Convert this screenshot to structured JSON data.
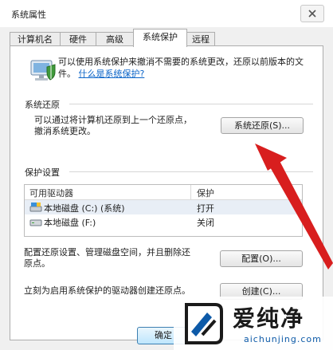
{
  "window": {
    "title": "系统属性"
  },
  "tabs": [
    {
      "label": "计算机名",
      "active": false
    },
    {
      "label": "硬件",
      "active": false
    },
    {
      "label": "高级",
      "active": false
    },
    {
      "label": "系统保护",
      "active": true
    },
    {
      "label": "远程",
      "active": false
    }
  ],
  "intro": {
    "text": "可以使用系统保护来撤消不需要的系统更改，还原以前版本的文件。",
    "link": "什么是系统保护?"
  },
  "restore": {
    "section_label": "系统还原",
    "desc_line1": "可以通过将计算机还原到上一个还原点，",
    "desc_line2": "撤消系统更改。",
    "button_label": "系统还原(S)..."
  },
  "protection": {
    "section_label": "保护设置",
    "columns": [
      "可用驱动器",
      "保护"
    ],
    "rows": [
      {
        "drive": "本地磁盘 (C:) (系统)",
        "status": "打开",
        "selected": true
      },
      {
        "drive": "本地磁盘 (F:)",
        "status": "关闭",
        "selected": false
      }
    ],
    "config_desc_line1": "配置还原设置、管理磁盘空间，并且删除还",
    "config_desc_line2": "原点。",
    "config_button": "配置(O)...",
    "create_desc": "立刻为启用系统保护的驱动器创建还原点。",
    "create_button": "创建(C)..."
  },
  "footer": {
    "ok_label": "确定"
  },
  "watermark": {
    "brand": "爱纯净",
    "url": "aichunjing.com"
  },
  "colors": {
    "arrow": "#d81e1e",
    "link": "#0a64c8",
    "watermark_blue": "#0d5aa8"
  }
}
